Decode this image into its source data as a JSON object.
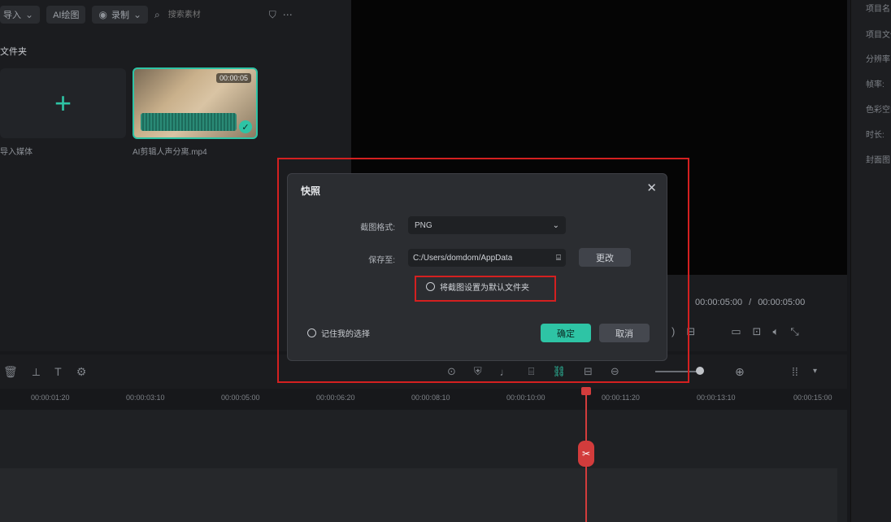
{
  "media": {
    "import_label": "导入",
    "ai_draw_label": "AI绘图",
    "record_label": "录制",
    "search_placeholder": "搜索素材",
    "folder_label": "文件夹",
    "import_media_label": "导入媒体",
    "clip_filename": "AI剪辑人声分离.mp4",
    "clip_duration": "00:00:05"
  },
  "player": {
    "current_time": "00:00:05:00",
    "total_time": "00:00:05:00",
    "separator": "/"
  },
  "properties": {
    "items": [
      "项目名",
      "项目文件",
      "分辨率",
      "帧率:",
      "色彩空间",
      "时长:",
      "封面图"
    ]
  },
  "timeline": {
    "ticks": [
      "00:00:01:20",
      "00:00:03:10",
      "00:00:05:00",
      "00:00:06:20",
      "00:00:08:10",
      "00:00:10:00",
      "00:00:11:20",
      "00:00:13:10",
      "00:00:15:00"
    ]
  },
  "dialog": {
    "title": "快照",
    "format_label": "截图格式:",
    "format_value": "PNG",
    "save_label": "保存至:",
    "save_path": "C:/Users/domdom/AppData",
    "change_label": "更改",
    "default_folder_option": "将截图设置为默认文件夹",
    "remember_option": "记住我的选择",
    "confirm_label": "确定",
    "cancel_label": "取消"
  },
  "colors": {
    "accent": "#2ec4a5",
    "highlight": "#d42020",
    "playhead": "#d23c3c"
  }
}
